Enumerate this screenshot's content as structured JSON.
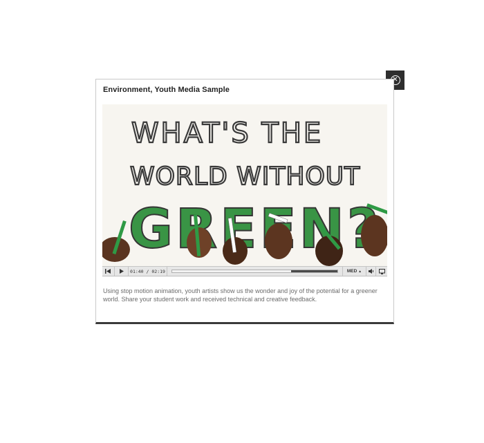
{
  "modal": {
    "title": "Environment, Youth Media Sample",
    "description": "Using stop motion animation, youth artists show us the wonder and joy of the potential for a greener world. Share your student work and received technical and creative feedback."
  },
  "video": {
    "frame_text": {
      "line1": "WHAT'S THE",
      "line2": "WORLD WITHOUT",
      "line3": "GREEN?"
    },
    "accent_green": "#2f8f3c"
  },
  "player": {
    "current_time": "01:40",
    "separator": "/",
    "duration": "02:19",
    "progress_fraction": 0.72,
    "quality_label": "MED",
    "rewind_icon": "rewind-icon",
    "play_icon": "play-icon",
    "volume_icon": "volume-icon",
    "fullscreen_icon": "fullscreen-icon"
  },
  "close": {
    "icon": "close-icon"
  }
}
